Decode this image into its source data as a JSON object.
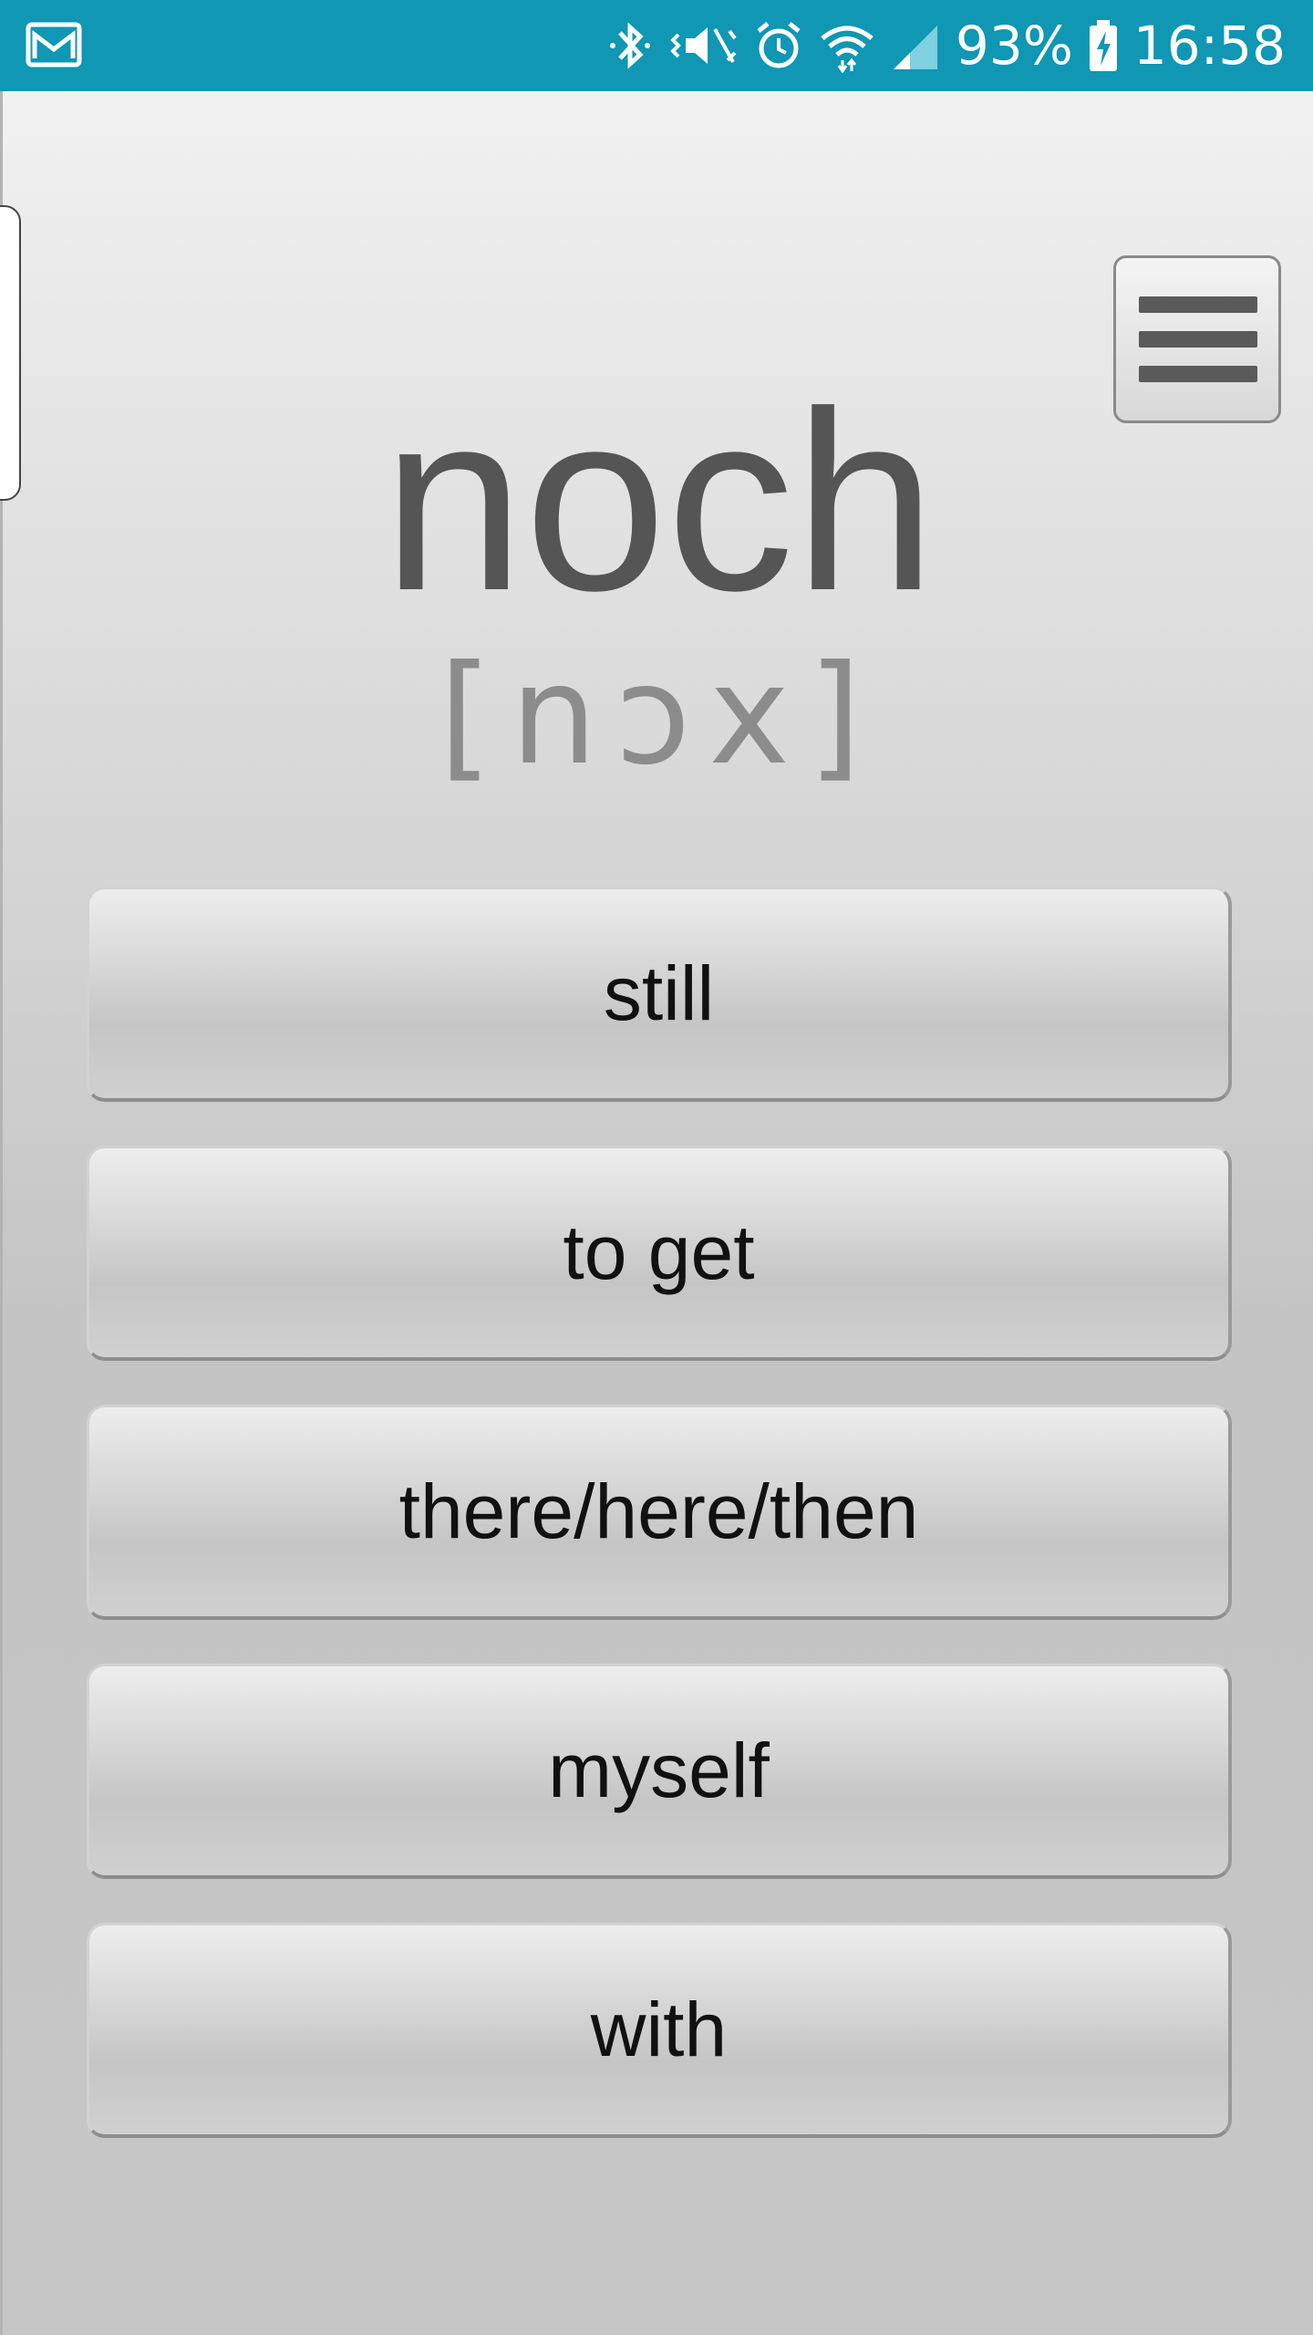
{
  "status_bar": {
    "battery_percent": "93%",
    "time": "16:58",
    "icons": [
      "mail-notification-icon",
      "bluetooth-icon",
      "vibrate-mute-icon",
      "alarm-icon",
      "wifi-icon",
      "cell-signal-icon",
      "battery-charging-icon"
    ]
  },
  "card": {
    "word": "noch",
    "pronunciation": "[nɔx]"
  },
  "menu": {
    "icon": "hamburger-menu-icon"
  },
  "answers": [
    {
      "label": "still"
    },
    {
      "label": "to get"
    },
    {
      "label": "there/here/then"
    },
    {
      "label": "myself"
    },
    {
      "label": "with"
    }
  ],
  "colors": {
    "status_bar": "#0f97b3",
    "word": "#555555",
    "pronunciation": "#8c8c8c"
  }
}
